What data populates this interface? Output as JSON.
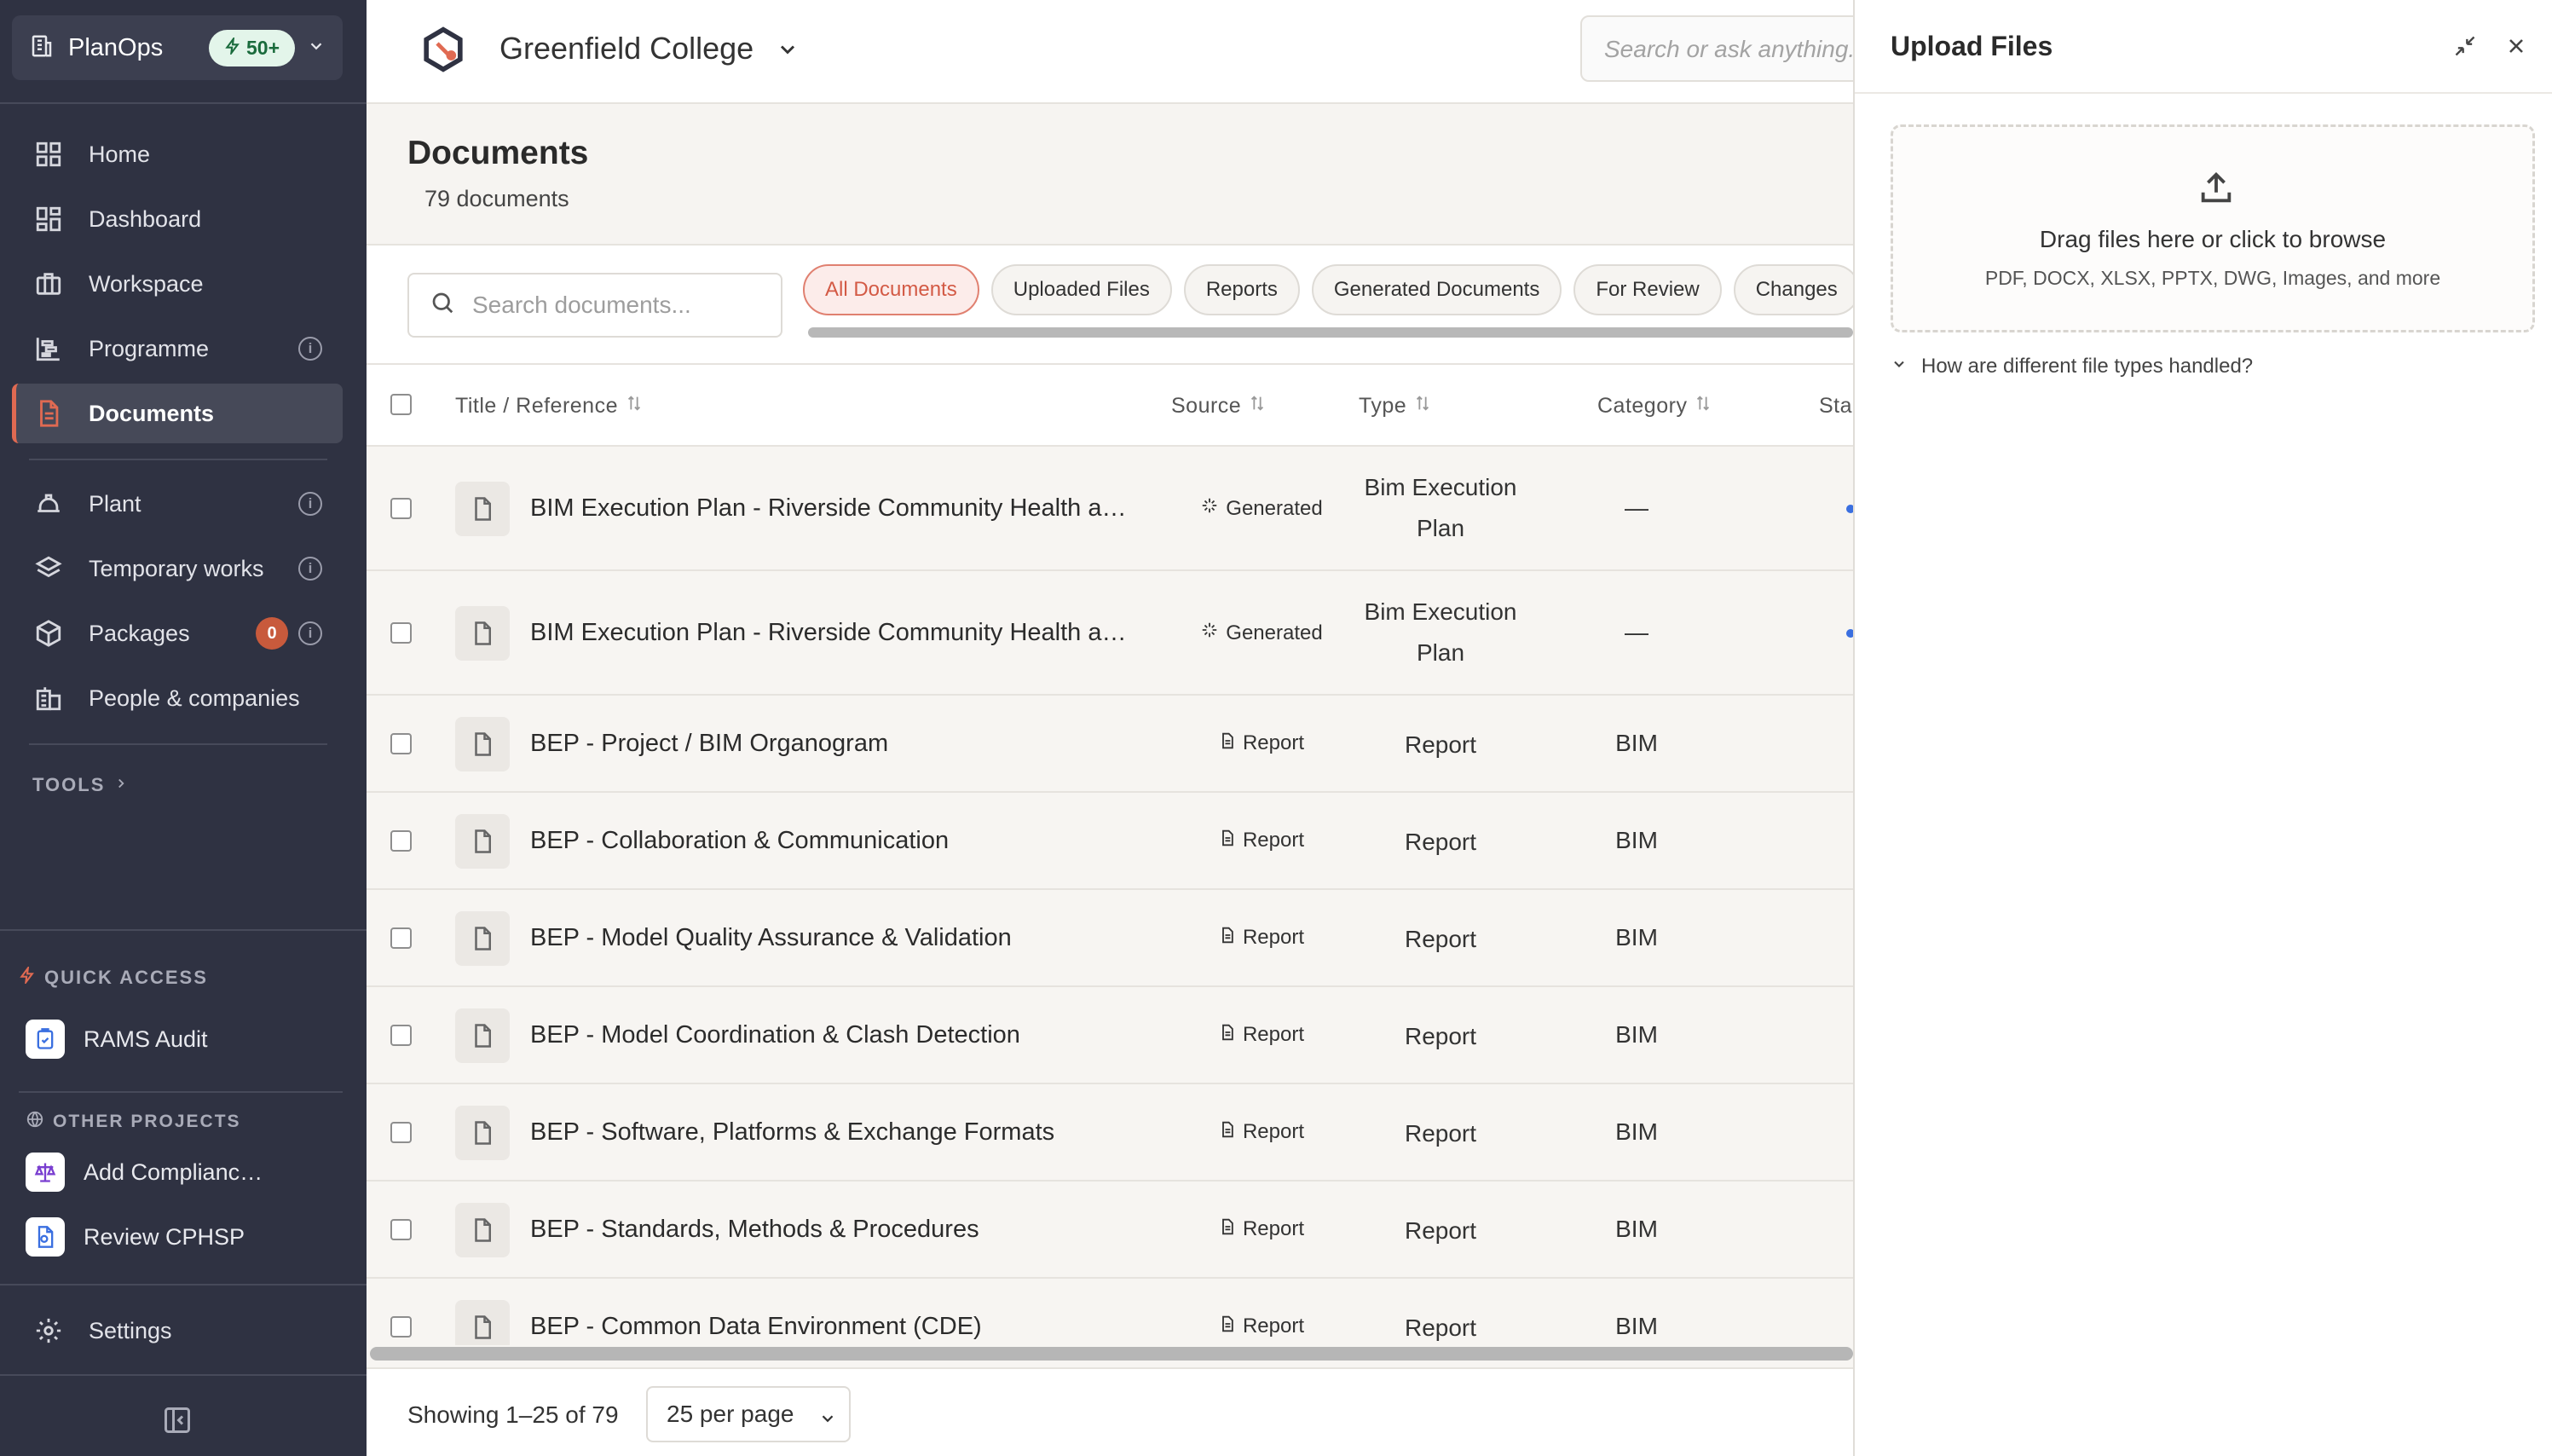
{
  "sidebar": {
    "brand": "PlanOps",
    "badge": "50+",
    "nav": [
      {
        "label": "Home"
      },
      {
        "label": "Dashboard"
      },
      {
        "label": "Workspace"
      },
      {
        "label": "Programme"
      },
      {
        "label": "Documents"
      },
      {
        "label": "Plant"
      },
      {
        "label": "Temporary works"
      },
      {
        "label": "Packages",
        "badge": "0"
      },
      {
        "label": "People & companies"
      }
    ],
    "tools_label": "TOOLS",
    "quick_access_label": "QUICK ACCESS",
    "quick_access": [
      {
        "label": "RAMS Audit"
      }
    ],
    "other_projects_label": "OTHER PROJECTS",
    "other_projects": [
      {
        "label": "Add Complianc…"
      },
      {
        "label": "Review CPHSP"
      }
    ],
    "settings_label": "Settings"
  },
  "header": {
    "project": "Greenfield College",
    "search_placeholder": "Search or ask anything..."
  },
  "documents": {
    "title": "Documents",
    "count": "79 documents",
    "search_placeholder": "Search documents...",
    "filters": [
      "All Documents",
      "Uploaded Files",
      "Reports",
      "Generated Documents",
      "For Review",
      "Changes"
    ],
    "active_filter": "All Documents",
    "columns": {
      "title": "Title / Reference",
      "source": "Source",
      "type": "Type",
      "category": "Category",
      "status": "Sta"
    },
    "rows": [
      {
        "title": "BIM Execution Plan - Riverside Community Health an…",
        "source": "Generated",
        "type": "Bim Execution Plan",
        "category": "—",
        "status_visible": true
      },
      {
        "title": "BIM Execution Plan - Riverside Community Health an…",
        "source": "Generated",
        "type": "Bim Execution Plan",
        "category": "—",
        "status_visible": true
      },
      {
        "title": "BEP - Project / BIM Organogram",
        "source": "Report",
        "type": "Report",
        "category": "BIM"
      },
      {
        "title": "BEP - Collaboration & Communication",
        "source": "Report",
        "type": "Report",
        "category": "BIM"
      },
      {
        "title": "BEP - Model Quality Assurance & Validation",
        "source": "Report",
        "type": "Report",
        "category": "BIM"
      },
      {
        "title": "BEP - Model Coordination & Clash Detection",
        "source": "Report",
        "type": "Report",
        "category": "BIM"
      },
      {
        "title": "BEP - Software, Platforms & Exchange Formats",
        "source": "Report",
        "type": "Report",
        "category": "BIM"
      },
      {
        "title": "BEP - Standards, Methods & Procedures",
        "source": "Report",
        "type": "Report",
        "category": "BIM"
      },
      {
        "title": "BEP - Common Data Environment (CDE)",
        "source": "Report",
        "type": "Report",
        "category": "BIM"
      }
    ],
    "footer_text": "Showing 1–25 of 79",
    "per_page": "25 per page"
  },
  "upload": {
    "title": "Upload Files",
    "drop_text": "Drag files here or click to browse",
    "formats": "PDF, DOCX, XLSX, PPTX, DWG, Images, and more",
    "faq": "How are different file types handled?"
  },
  "colors": {
    "sidebar_bg": "#2f3242",
    "accent": "#e06a52",
    "badge_green": "#1a6b3c",
    "status_blue": "#3a6fe0"
  }
}
